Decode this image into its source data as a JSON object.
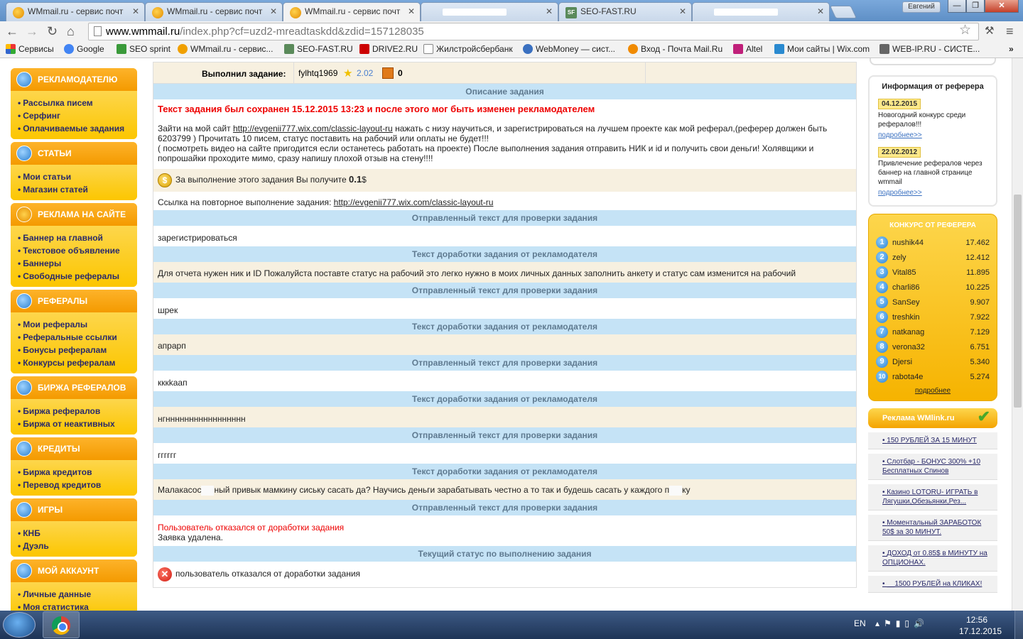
{
  "browser": {
    "tabs": [
      {
        "title": "WMmail.ru - сервис почт",
        "active": false,
        "icon": "wmmail-favicon"
      },
      {
        "title": "WMmail.ru - сервис почт",
        "active": false,
        "icon": "wmmail-favicon"
      },
      {
        "title": "WMmail.ru - сервис почт",
        "active": true,
        "icon": "wmmail-favicon"
      },
      {
        "title": "",
        "active": false,
        "icon": "blurred"
      },
      {
        "title": "SEO-FAST.RU",
        "active": false,
        "icon": "seofast-favicon"
      },
      {
        "title": "",
        "active": false,
        "icon": "blurred"
      }
    ],
    "user": "Евгений",
    "url_host": "www.wmmail.ru",
    "url_path": "/index.php?cf=uzd2-mreadtaskdd&zdid=157128035",
    "bookmarks": [
      "Сервисы",
      "Google",
      "SEO sprint",
      "WMmail.ru - сервис...",
      "SEO-FAST.RU",
      "DRIVE2.RU",
      "Жилстройсбербанк",
      "WebMoney — сист...",
      "Вход - Почта Mail.Ru",
      "Altel",
      "Мои сайты | Wix.com",
      "WEB-IP.RU - СИСТЕ..."
    ],
    "more": "»"
  },
  "left_sidebar": [
    {
      "title": "РЕКЛАМОДАТЕЛЮ",
      "items": [
        "Рассылка писем",
        "Серфинг",
        "Оплачиваемые задания"
      ]
    },
    {
      "title": "СТАТЬИ",
      "items": [
        "Мои статьи",
        "Магазин статей"
      ]
    },
    {
      "title": "РЕКЛАМА НА САЙТЕ",
      "items": [
        "Баннер на главной",
        "Текстовое объявление",
        "Баннеры",
        "Свободные рефералы"
      ]
    },
    {
      "title": "РЕФЕРАЛЫ",
      "items": [
        "Мои рефералы",
        "Реферальные ссылки",
        "Бонусы рефералам",
        "Конкурсы рефералам"
      ]
    },
    {
      "title": "БИРЖА РЕФЕРАЛОВ",
      "items": [
        "Биржа рефералов",
        "Биржа от неактивных"
      ]
    },
    {
      "title": "КРЕДИТЫ",
      "items": [
        "Биржа кредитов",
        "Перевод кредитов"
      ]
    },
    {
      "title": "ИГРЫ",
      "items": [
        "КНБ",
        "Дуэль"
      ]
    },
    {
      "title": "МОЙ АККАУНТ",
      "items": [
        "Личные данные",
        "Моя статистика"
      ]
    }
  ],
  "task": {
    "performer_label": "Выполнил задание:",
    "performer_name": "fylhtq1969",
    "performer_rating": "2.02",
    "performer_count": "0",
    "desc_header": "Описание задания",
    "saved_notice": "Текст задания был сохранен 15.12.2015 13:23 и после этого мог быть изменен рекламодателем",
    "desc_before": "Зайти на мой сайт ",
    "desc_link": "http://evgenii777.wix.com/classic-layout-ru",
    "desc_after": " нажать с низу научиться, и зарегистрироваться на лучшем проекте как мой реферал,(реферер должен быть 6203799 ) Прочитать 10 писем, статус поставить на рабочий или оплаты не будет!!!",
    "desc_line2": "( посмотреть видео на сайте пригодится если останетесь работать на проекте) После выполнения задания отправить НИК и id и получить свои деньги! Холявщики и попрошайки проходите мимо, сразу напишу плохой отзыв на стену!!!!",
    "reward_text": "За выполнение этого задания Вы получите ",
    "reward_value": "0.1",
    "reward_unit": "$",
    "repeat_label": "Ссылка на повторное выполнение задания: ",
    "repeat_link": "http://evgenii777.wix.com/classic-layout-ru",
    "exchanges": [
      {
        "header": "Отправленный текст для проверки задания",
        "text": "зарегистрироваться",
        "bg": "white"
      },
      {
        "header": "Текст доработки задания от рекламодателя",
        "text": "Для отчета нужен ник и ID Пожалуйста поставте статус на рабочий это легко нужно в моих личных данных заполнить анкету и статус сам изменится на рабочий",
        "bg": "beige"
      },
      {
        "header": "Отправленный текст для проверки задания",
        "text": "шрек",
        "bg": "white"
      },
      {
        "header": "Текст доработки задания от рекламодателя",
        "text": "апрарп",
        "bg": "beige"
      },
      {
        "header": "Отправленный текст для проверки задания",
        "text": "кккkаап",
        "bg": "white"
      },
      {
        "header": "Текст доработки задания от рекламодателя",
        "text": "нгннннннннннннннннн",
        "bg": "beige"
      },
      {
        "header": "Отправленный текст для проверки задания",
        "text": "гггггг",
        "bg": "white"
      }
    ],
    "last_edit_header": "Текст доработки задания от рекламодателя",
    "last_edit_part1": "Малакасос",
    "last_edit_part2": "ный привык мамкину сиську сасать да? Научись деньги зарабатывать честно а то так и будешь сасать у каждого п",
    "last_edit_part3": "ку",
    "last_sent_header": "Отправленный текст для проверки задания",
    "refused_text": "Пользователь отказался от доработки задания",
    "deleted_text": "Заявка удалена.",
    "status_header": "Текущий статус по выполнению задания",
    "status_text": "пользователь отказался от доработки задания"
  },
  "right_sidebar": {
    "referrer_info_title": "Информация от реферера",
    "news": [
      {
        "date": "04.12.2015",
        "text": "Новогодний конкурс среди рефералов!!!",
        "more": "подробнее>>"
      },
      {
        "date": "22.02.2012",
        "text": "Привлечение рефералов через баннер на главной странице wmmail",
        "more": "подробнее>>"
      }
    ],
    "contest_title": "КОНКУРС ОТ РЕФЕРЕРА",
    "contest": [
      {
        "rank": "1",
        "name": "nushik44",
        "value": "17.462"
      },
      {
        "rank": "2",
        "name": "zely",
        "value": "12.412"
      },
      {
        "rank": "3",
        "name": "Vital85",
        "value": "11.895"
      },
      {
        "rank": "4",
        "name": "charli86",
        "value": "10.225"
      },
      {
        "rank": "5",
        "name": "SanSey",
        "value": "9.907"
      },
      {
        "rank": "6",
        "name": "treshkin",
        "value": "7.922"
      },
      {
        "rank": "7",
        "name": "natkanag",
        "value": "7.129"
      },
      {
        "rank": "8",
        "name": "verona32",
        "value": "6.751"
      },
      {
        "rank": "9",
        "name": "Djersi",
        "value": "5.340"
      },
      {
        "rank": "10",
        "name": "rabota4e",
        "value": "5.274"
      }
    ],
    "contest_more": "подробнее",
    "wmlink_title": "Реклама WMlink.ru",
    "ads": [
      "150 РУБЛЕЙ ЗА 15 МИНУТ",
      "Слотбар - БОНУС 300% +10 Бесплатных Спинов",
      "Казино LOTORU- ИГРАТЬ в Лягушки,Обезьянки,Рез...",
      "Моментальный ЗАРАБОТОК 50$ за 30 МИНУТ.",
      "ДОХОД от 0.85$ в МИНУТУ на ОПЦИОНАХ.",
      "__1500 РУБЛЕЙ на КЛИКАХ!"
    ]
  },
  "taskbar": {
    "lang": "EN",
    "time": "12:56",
    "date": "17.12.2015"
  }
}
